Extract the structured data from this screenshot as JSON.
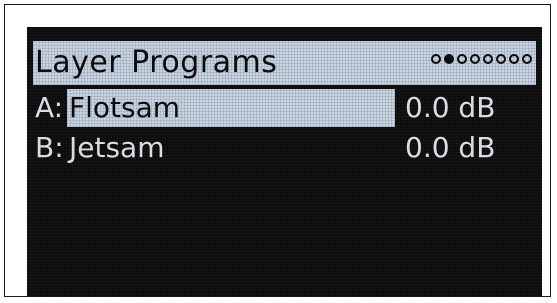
{
  "screen": {
    "title": "Layer Programs",
    "pages": {
      "total": 8,
      "current": 2
    }
  },
  "layers": [
    {
      "slot": "A:",
      "program": "Flotsam",
      "level": "0.0 dB",
      "selected": true
    },
    {
      "slot": "B:",
      "program": "Jetsam",
      "level": "0.0 dB",
      "selected": false
    }
  ],
  "colors": {
    "screen_bg": "#0c0c0c",
    "highlight": "#c6d3e2",
    "text": "#d8dde4"
  }
}
